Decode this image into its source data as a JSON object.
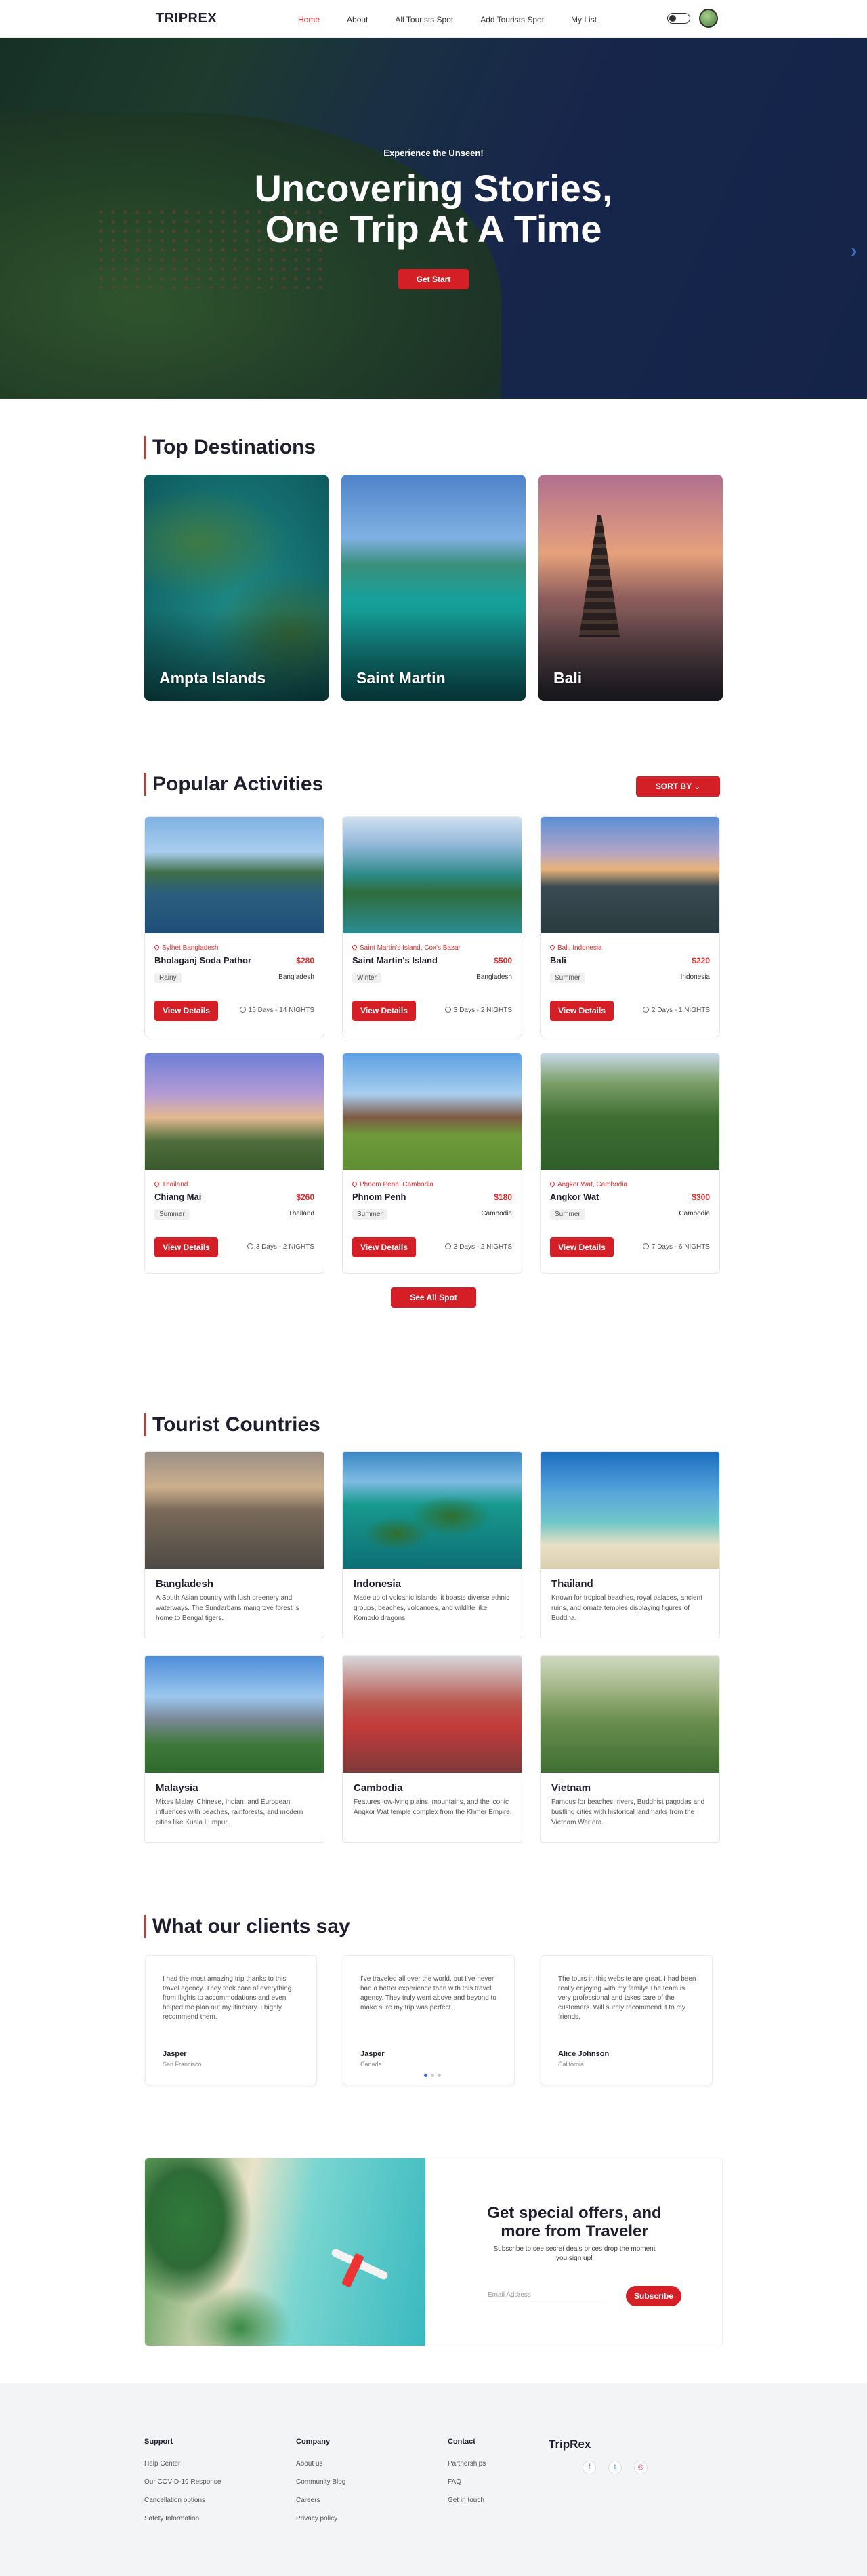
{
  "nav": {
    "logo": "TRIPREX",
    "items": [
      "Home",
      "About",
      "All Tourists Spot",
      "Add Tourists Spot",
      "My List"
    ]
  },
  "hero": {
    "subtitle": "Experience the Unseen!",
    "title_line1": "Uncovering Stories,",
    "title_line2": "One Trip At A Time",
    "cta": "Get Start",
    "next_arrow": "›"
  },
  "destinations": {
    "title": "Top Destinations",
    "items": [
      "Ampta Islands",
      "Saint Martin",
      "Bali"
    ]
  },
  "activities": {
    "title": "Popular Activities",
    "sort_label": "SORT BY",
    "view_details": "View Details",
    "see_all": "See All Spot",
    "cards": [
      {
        "location": "Sylhet Bangladesh",
        "name": "Bholaganj Soda Pathor",
        "price": "$280",
        "season": "Rainy",
        "country": "Bangladesh",
        "duration": "15 Days - 14 NIGHTS"
      },
      {
        "location": "Saint Martin's Island, Cox's Bazar",
        "name": "Saint Martin's Island",
        "price": "$500",
        "season": "Winter",
        "country": "Bangladesh",
        "duration": "3 Days - 2 NIGHTS"
      },
      {
        "location": "Bali, Indonesia",
        "name": "Bali",
        "price": "$220",
        "season": "Summer",
        "country": "Indonesia",
        "duration": "2 Days - 1 NIGHTS"
      },
      {
        "location": "Thailand",
        "name": "Chiang Mai",
        "price": "$260",
        "season": "Summer",
        "country": "Thailand",
        "duration": "3 Days - 2 NIGHTS"
      },
      {
        "location": "Phnom Penh, Cambodia",
        "name": "Phnom Penh",
        "price": "$180",
        "season": "Summer",
        "country": "Cambodia",
        "duration": "3 Days - 2 NIGHTS"
      },
      {
        "location": "Angkor Wat, Cambodia",
        "name": "Angkor Wat",
        "price": "$300",
        "season": "Summer",
        "country": "Cambodia",
        "duration": "7 Days - 6 NIGHTS"
      }
    ]
  },
  "countries": {
    "title": "Tourist Countries",
    "items": [
      {
        "name": "Bangladesh",
        "desc": "A South Asian country with lush greenery and waterways. The Sundarbans mangrove forest is home to Bengal tigers."
      },
      {
        "name": "Indonesia",
        "desc": "Made up of volcanic islands, it boasts diverse ethnic groups, beaches, volcanoes, and wildlife like Komodo dragons."
      },
      {
        "name": "Thailand",
        "desc": "Known for tropical beaches, royal palaces, ancient ruins, and ornate temples displaying figures of Buddha."
      },
      {
        "name": "Malaysia",
        "desc": "Mixes Malay, Chinese, Indian, and European influences with beaches, rainforests, and modern cities like Kuala Lumpur."
      },
      {
        "name": "Cambodia",
        "desc": "Features low-lying plains, mountains, and the iconic Angkor Wat temple complex from the Khmer Empire."
      },
      {
        "name": "Vietnam",
        "desc": "Famous for beaches, rivers, Buddhist pagodas and bustling cities with historical landmarks from the Vietnam War era."
      }
    ]
  },
  "testimonials": {
    "title": "What our clients say",
    "items": [
      {
        "quote": "I had the most amazing trip thanks to this travel agency. They took care of everything from flights to accommodations and even helped me plan out my itinerary. I highly recommend them.",
        "name": "Jasper",
        "place": "San Francisco"
      },
      {
        "quote": "I've traveled all over the world, but I've never had a better experience than with this travel agency. They truly went above and beyond to make sure my trip was perfect.",
        "name": "Jasper",
        "place": "Canada"
      },
      {
        "quote": "The tours in this website are great. I had been really enjoying with my family! The team is very professional and takes care of the customers. Will surely recommend it to my friends.",
        "name": "Alice Johnson",
        "place": "California"
      }
    ]
  },
  "newsletter": {
    "title_line1": "Get special offers, and",
    "title_line2": "more from Traveler",
    "subtitle": "Subscribe to see secret deals prices drop the moment you sign up!",
    "placeholder": "Email Address",
    "button": "Subscribe"
  },
  "footer": {
    "columns": [
      {
        "heading": "Support",
        "links": [
          "Help Center",
          "Our COVID-19 Response",
          "Cancellation options",
          "Safety Information"
        ]
      },
      {
        "heading": "Company",
        "links": [
          "About us",
          "Community Blog",
          "Careers",
          "Privacy policy"
        ]
      },
      {
        "heading": "Contact",
        "links": [
          "Partnerships",
          "FAQ",
          "Get in touch"
        ]
      }
    ],
    "brand": "TripRex",
    "social": [
      "f",
      "t",
      "◎"
    ]
  },
  "colors": {
    "accent": "#d41f26",
    "text": "#1e1e2f"
  }
}
